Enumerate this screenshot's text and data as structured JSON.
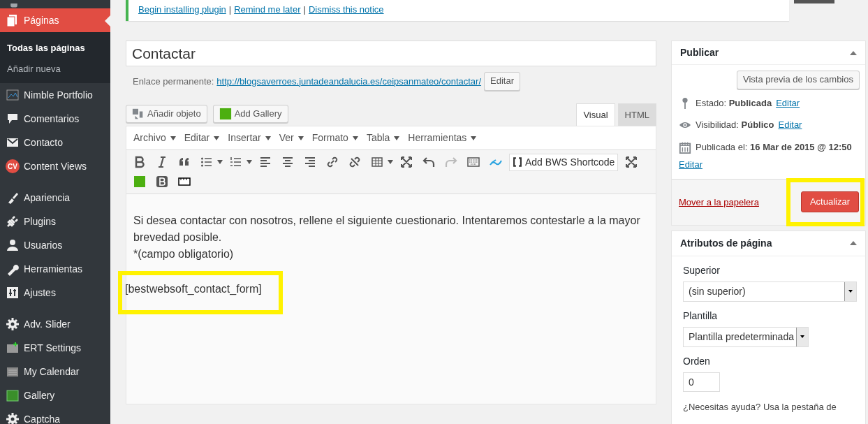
{
  "sidebar": {
    "groups": [
      [
        {
          "label": "Páginas",
          "selected": true,
          "children": [
            {
              "label": "Todas las páginas",
              "selected": true
            },
            {
              "label": "Añadir nueva",
              "selected": false
            }
          ]
        },
        {
          "label": "Nimble Portfolio",
          "selected": false
        },
        {
          "label": "Comentarios",
          "selected": false
        },
        {
          "label": "Contacto",
          "selected": false
        },
        {
          "label": "Content Views",
          "selected": false,
          "badge": "CV"
        }
      ],
      [
        {
          "label": "Apariencia",
          "selected": false
        },
        {
          "label": "Plugins",
          "selected": false
        },
        {
          "label": "Usuarios",
          "selected": false
        },
        {
          "label": "Herramientas",
          "selected": false
        },
        {
          "label": "Ajustes",
          "selected": false
        }
      ],
      [
        {
          "label": "Adv. Slider",
          "selected": false
        },
        {
          "label": "ERT Settings",
          "selected": false
        },
        {
          "label": "My Calendar",
          "selected": false
        },
        {
          "label": "Gallery",
          "selected": false
        },
        {
          "label": "Captcha",
          "selected": false
        }
      ]
    ]
  },
  "notice": {
    "links": [
      "Begin installing plugin",
      "Remind me later",
      "Dismiss this notice"
    ],
    "separator": "|"
  },
  "title": "Contactar",
  "permalink": {
    "label": "Enlace permanente:",
    "url_base": "http://blogsaverroes.juntadeandalucia.es/ceipsanmateo/",
    "slug": "contactar/",
    "button": "Editar"
  },
  "media_buttons": [
    "Añadir objeto",
    "Add Gallery"
  ],
  "tabs": [
    {
      "label": "Visual",
      "selected": true
    },
    {
      "label": "HTML",
      "selected": false
    }
  ],
  "menubar": [
    "Archivo",
    "Editar",
    "Insertar",
    "Ver",
    "Formato",
    "Tabla",
    "Herramientas"
  ],
  "shortcode_button": "Add BWS Shortcode",
  "content": [
    {
      "text": "Si desea contactar con nosotros, rellene el siguiente cuestionario. Intentaremos contestarle a la mayor brevedad posible.\n*(campo obligatorio)",
      "highlighted": false
    },
    {
      "text": "[bestwebsoft_contact_form]",
      "highlighted": true
    }
  ],
  "publish": {
    "title": "Publicar",
    "preview": "Vista previa de los cambios",
    "rows": [
      {
        "label": "Estado:",
        "value": "Publicada",
        "link": "Editar"
      },
      {
        "label": "Visibilidad:",
        "value": "Público",
        "link": "Editar"
      },
      {
        "label": "Publicada el:",
        "value": "16 Mar de 2015 @ 12:50",
        "link": "Editar"
      }
    ],
    "trash": "Mover a la papelera",
    "update": "Actualizar",
    "update_highlighted": true
  },
  "attributes": {
    "title": "Atributos de página",
    "fields": [
      {
        "kind": "select",
        "label": "Superior",
        "value": "(sin superior)"
      },
      {
        "kind": "select",
        "label": "Plantilla",
        "value": "Plantilla predeterminada"
      },
      {
        "kind": "input",
        "label": "Orden",
        "value": "0"
      }
    ],
    "help": "¿Necesitas ayuda? Usa la pestaña de"
  }
}
